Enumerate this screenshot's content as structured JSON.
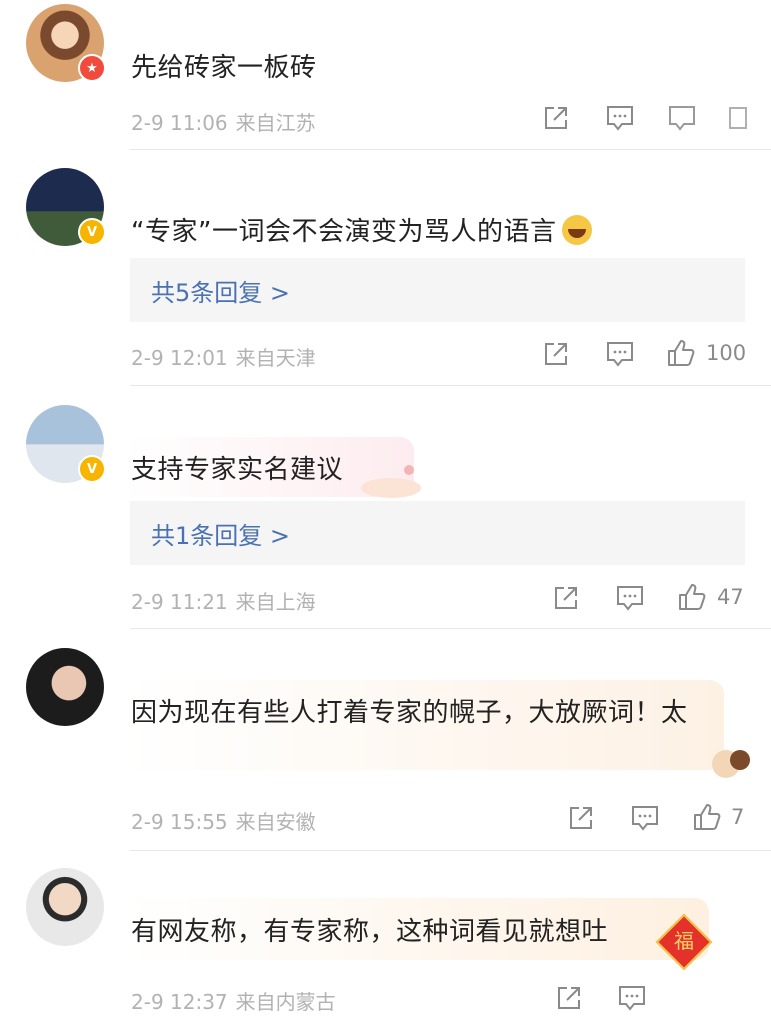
{
  "comments": [
    {
      "text": "先给砖家一板砖",
      "time": "2-9 11:06",
      "location": "来自江苏",
      "reply_label": "",
      "likes": ""
    },
    {
      "text": "“专家”一词会不会演变为骂人的语言",
      "time": "2-9 12:01",
      "location": "来自天津",
      "reply_label": "共5条回复 >",
      "likes": "100"
    },
    {
      "text": "支持专家实名建议",
      "time": "2-9 11:21",
      "location": "来自上海",
      "reply_label": "共1条回复 >",
      "likes": "47"
    },
    {
      "text": "因为现在有些人打着专家的幌子，大放厥词！太",
      "time": "2-9 15:55",
      "location": "来自安徽",
      "reply_label": "",
      "likes": "7"
    },
    {
      "text": "有网友称，有专家称，这种词看见就想吐",
      "time": "2-9 12:37",
      "location": "来自内蒙古",
      "reply_label": "",
      "likes": ""
    }
  ],
  "sticker_text": "福",
  "icons": {
    "share": "share-icon",
    "comment": "comment-icon",
    "like": "thumbs-up-icon",
    "emoji": "grinning-emoji-icon"
  },
  "colors": {
    "link_blue": "#4a72b2",
    "meta_gray": "#b2b2b2",
    "reply_bg": "#f5f5f5"
  }
}
